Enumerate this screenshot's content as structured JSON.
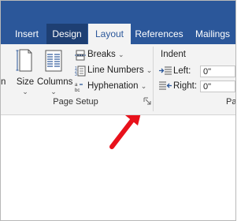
{
  "tabs": [
    "Insert",
    "Design",
    "Layout",
    "References",
    "Mailings"
  ],
  "ribbon": {
    "margins_label_fragment": "n",
    "size_label": "Size",
    "columns_label": "Columns",
    "breaks_label": "Breaks",
    "line_numbers_label": "Line Numbers",
    "hyphenation_label": "Hyphenation",
    "caret": "⌄",
    "page_setup_label": "Page Setup"
  },
  "indent": {
    "title": "Indent",
    "left_label": "Left:",
    "left_value": "0\"",
    "right_label": "Right:",
    "right_value": "0\""
  },
  "paragraph_label_fragment": "Pa",
  "colors": {
    "accent": "#2b579a",
    "arrow": "#e8111b"
  },
  "icons": [
    "page-size-icon",
    "columns-icon",
    "breaks-icon",
    "line-numbers-icon",
    "hyphenation-icon",
    "dialog-launcher-icon",
    "indent-left-icon",
    "indent-right-icon",
    "red-arrow"
  ]
}
